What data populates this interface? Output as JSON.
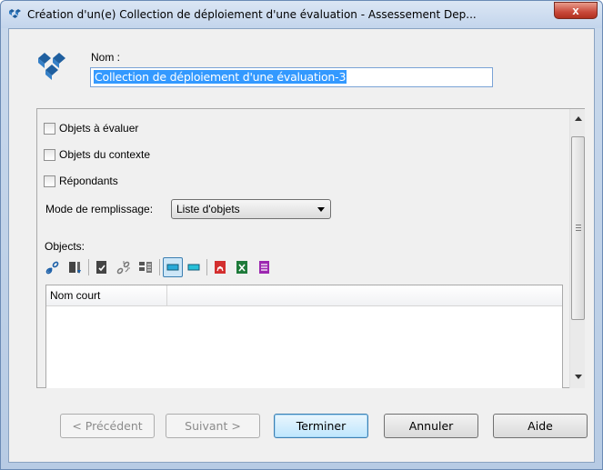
{
  "window": {
    "title": "Création d'un(e) Collection de déploiement d'une évaluation - Assessement Dep...",
    "close_label": "x"
  },
  "header": {
    "name_label": "Nom :",
    "name_value": "Collection de déploiement d'une évaluation-3"
  },
  "checkboxes": [
    {
      "label": "Objets à évaluer",
      "checked": false
    },
    {
      "label": "Objets du contexte",
      "checked": false
    },
    {
      "label": "Répondants",
      "checked": false
    }
  ],
  "mode": {
    "label": "Mode de remplissage:",
    "selected": "Liste d'objets"
  },
  "objects": {
    "label": "Objects:",
    "toolbar_icons": [
      "link-icon",
      "move-down-icon",
      "properties-icon",
      "unlink-icon",
      "import-icon",
      "select-all-icon",
      "deselect-icon",
      "pdf-icon",
      "excel-icon",
      "document-icon"
    ],
    "columns": [
      "Nom court"
    ]
  },
  "buttons": {
    "previous": "< Précédent",
    "next": "Suivant >",
    "finish": "Terminer",
    "cancel": "Annuler",
    "help": "Aide"
  },
  "colors": {
    "accent": "#3399ff",
    "pdf": "#d32f2f",
    "excel": "#1e7a3a",
    "document": "#9c27b0"
  }
}
